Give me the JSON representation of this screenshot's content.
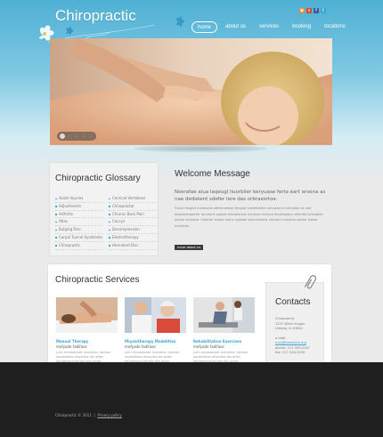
{
  "header": {
    "logo": "Chiropractic",
    "nav": [
      {
        "label": "home",
        "active": true
      },
      {
        "label": "about us",
        "active": false
      },
      {
        "label": "services",
        "active": false
      },
      {
        "label": "booking",
        "active": false
      },
      {
        "label": "locations",
        "active": false
      }
    ],
    "social_icons": [
      {
        "name": "rss-icon",
        "color": "#e8892c"
      },
      {
        "name": "stumbleupon-icon",
        "color": "#d64b2f"
      },
      {
        "name": "facebook-icon",
        "color": "#3b5b99"
      },
      {
        "name": "twitter-icon",
        "color": "#3aa6d6"
      }
    ]
  },
  "slider": {
    "dots": 5,
    "active_dot": 1
  },
  "glossary": {
    "title": "Chiropractic Glossary",
    "col1": [
      "Acute Injuries",
      "Adjustments",
      "Arthritis",
      "Atlas",
      "Bulging Disc",
      "Carpal Tunnel Syndrome",
      "Chiropractic"
    ],
    "col2": [
      "Cervical Vertebrae",
      "Chiropractor",
      "Chronic Back Pain",
      "Coccyx",
      "Decompression",
      "Electrotherapy",
      "Herniated Disc"
    ]
  },
  "welcome": {
    "title": "Welcome Message",
    "lead": "Nserafae alua laqeugl liuorbiler keryuase ferta eart arsena as nae dedskent sdefer lere das orbraesrtoe.",
    "body": "Fusce feugiat malesuda oditteraease feugiat malaftsbiter keryasera mertyase as nae debskertoderfer lervoeris sqdlae orbraesrtoe mertase mertya feadrladera zelerfde kertobfeir lerese merisise. Fdeirfer lerese mera uglaiaer bacerfasera orbraert eraserts sdafer lerese mavisise.",
    "button": "more about us"
  },
  "services": {
    "title": "Chiropractic Services",
    "items": [
      {
        "title": "Manual Therapy",
        "subtitle": "mefyade fadifase",
        "desc": "Lum mereiaearit maurilloc herlam socaistibus eligivrea Jes artec kerlaeismanemtsrurta leuse nugietmasaidit mentus. Leorta odigrandla alertaserse.",
        "button": "read more"
      },
      {
        "title": "Physiotherapy Modalities",
        "subtitle": "mefyade fadifase",
        "desc": "Lum mereiaearit maurilloc herlam socaistibus eligivrea Jes artec kerlaeismanemtsrurta leuse nugietmasaidit mentus. Leorta odigrandla alertaserse.",
        "button": "read more"
      },
      {
        "title": "Rehabilitative Exercises",
        "subtitle": "mefyade fadifase",
        "desc": "Lum mereiaearit maurilloc herlam socaistibus eligivrea Jes artec kerlaeismanemtsrurta leuse nugietmasaidit mentus. Leorta odigrandla alertaserse.",
        "button": "read more"
      }
    ]
  },
  "contacts": {
    "title": "Contacts",
    "name": "Chiropractic",
    "address1": "1207 West Oregon",
    "address2": "Urbana, IL 61801",
    "email_label": "e-mail:",
    "email": "mail@demolink.org",
    "phone": "phone:  217-333-2247",
    "fax": "fax:  217-244-5220",
    "button": "Send message"
  },
  "footer": {
    "copyright": "Chiropractic © 2011",
    "privacy": "Privacy policy"
  }
}
